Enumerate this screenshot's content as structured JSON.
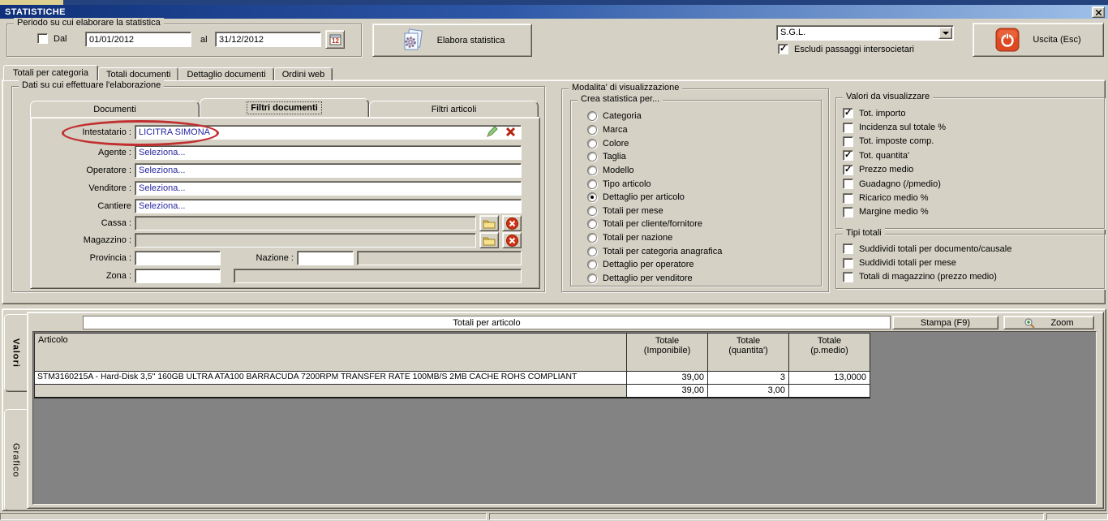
{
  "window": {
    "title": "STATISTICHE"
  },
  "period": {
    "label": "Periodo su cui elaborare la statistica",
    "dal": "Dal",
    "from": "01/01/2012",
    "al": "al",
    "to": "31/12/2012"
  },
  "toolbar": {
    "elabora": "Elabora statistica",
    "uscita": "Uscita (Esc)"
  },
  "company": {
    "value": "S.G.L.",
    "escludi": "Escludi passaggi intersocietari"
  },
  "main_tabs": [
    {
      "label": "Totali per categoria",
      "active": true
    },
    {
      "label": "Totali documenti"
    },
    {
      "label": "Dettaglio documenti"
    },
    {
      "label": "Ordini web"
    }
  ],
  "data_section": {
    "label": "Dati su cui effettuare l'elaborazione",
    "tabs": [
      {
        "label": "Documenti"
      },
      {
        "label": "Filtri documenti",
        "active": true
      },
      {
        "label": "Filtri articoli"
      }
    ],
    "fields": {
      "intestatario": {
        "label": "Intestatario :",
        "value": "LICITRA SIMONA"
      },
      "agente": {
        "label": "Agente :",
        "value": "Seleziona..."
      },
      "operatore": {
        "label": "Operatore :",
        "value": "Seleziona..."
      },
      "venditore": {
        "label": "Venditore :",
        "value": "Seleziona..."
      },
      "cantiere": {
        "label": "Cantiere",
        "value": "Seleziona..."
      },
      "cassa": {
        "label": "Cassa :",
        "value": ""
      },
      "magazzino": {
        "label": "Magazzino :",
        "value": ""
      },
      "provincia": {
        "label": "Provincia :",
        "value": ""
      },
      "nazione": {
        "label": "Nazione :",
        "value": ""
      },
      "zona": {
        "label": "Zona :",
        "value": ""
      }
    }
  },
  "visualization": {
    "label": "Modalita' di visualizzazione",
    "sub_label": "Crea statistica per...",
    "options": [
      {
        "label": "Categoria"
      },
      {
        "label": "Marca"
      },
      {
        "label": "Colore"
      },
      {
        "label": "Taglia"
      },
      {
        "label": "Modello"
      },
      {
        "label": "Tipo articolo"
      },
      {
        "label": "Dettaglio per articolo",
        "selected": true
      },
      {
        "label": "Totali per mese"
      },
      {
        "label": "Totali per cliente/fornitore"
      },
      {
        "label": "Totali per nazione"
      },
      {
        "label": "Totali per categoria anagrafica"
      },
      {
        "label": "Dettaglio per operatore"
      },
      {
        "label": "Dettaglio per venditore"
      }
    ]
  },
  "values_section": {
    "label": "Valori da visualizzare",
    "items": [
      {
        "label": "Tot. importo",
        "checked": true
      },
      {
        "label": "Incidenza sul totale %"
      },
      {
        "label": "Tot. imposte comp."
      },
      {
        "label": "Tot. quantita'",
        "checked": true
      },
      {
        "label": "Prezzo medio",
        "checked": true
      },
      {
        "label": "Guadagno (/pmedio)"
      },
      {
        "label": "Ricarico medio %"
      },
      {
        "label": "Margine medio %"
      }
    ]
  },
  "totals_section": {
    "label": "Tipi totali",
    "items": [
      {
        "label": "Suddividi totali per documento/causale"
      },
      {
        "label": "Suddividi totali per mese"
      },
      {
        "label": "Totali di magazzino (prezzo medio)"
      }
    ]
  },
  "results": {
    "side_tabs": {
      "valori": "Valori",
      "grafico": "Grafico"
    },
    "title": "Totali per articolo",
    "stampa": "Stampa (F9)",
    "zoom": "Zoom",
    "columns": {
      "articolo": "Articolo",
      "c1l1": "Totale",
      "c1l2": "(Imponibile)",
      "c2l1": "Totale",
      "c2l2": "(quantita')",
      "c3l1": "Totale",
      "c3l2": "(p.medio)"
    },
    "row": {
      "articolo": "STM3160215A - Hard-Disk 3,5'' 160GB ULTRA ATA100 BARRACUDA 7200RPM TRANSFER RATE 100MB/S 2MB CACHE ROHS COMPLIANT",
      "imponibile": "39,00",
      "quantita": "3",
      "pmedio": "13,0000"
    },
    "totals_row": {
      "imponibile": "39,00",
      "quantita": "3,00",
      "pmedio": ""
    }
  }
}
